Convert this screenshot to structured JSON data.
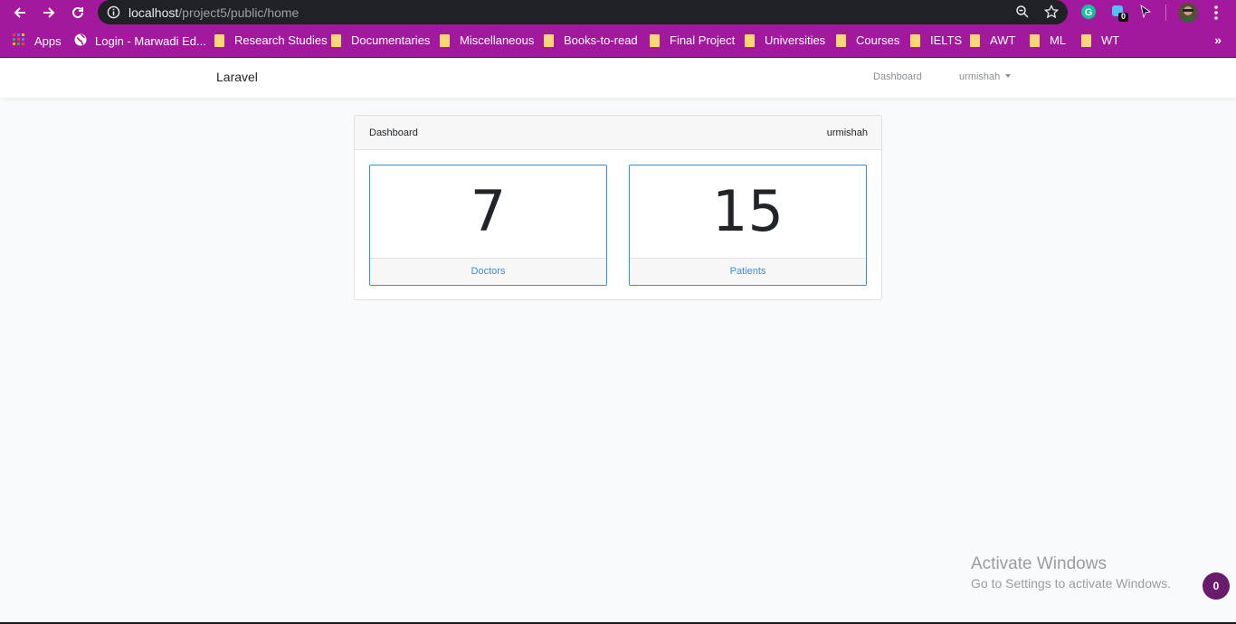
{
  "browser": {
    "url_host": "localhost",
    "url_path": "/project5/public/home",
    "extension_badge": "0",
    "bookmarks": [
      {
        "label": "Apps",
        "icon": "apps-grid-icon"
      },
      {
        "label": "Login - Marwadi Ed...",
        "icon": "globe-icon"
      },
      {
        "label": "Research Studies",
        "icon": "folder-icon"
      },
      {
        "label": "Documentaries",
        "icon": "folder-icon"
      },
      {
        "label": "Miscellaneous",
        "icon": "folder-icon"
      },
      {
        "label": "Books-to-read",
        "icon": "folder-icon"
      },
      {
        "label": "Final Project",
        "icon": "folder-icon"
      },
      {
        "label": "Universities",
        "icon": "folder-icon"
      },
      {
        "label": "Courses",
        "icon": "folder-icon"
      },
      {
        "label": "IELTS",
        "icon": "folder-icon"
      },
      {
        "label": "AWT",
        "icon": "folder-icon"
      },
      {
        "label": "ML",
        "icon": "folder-icon"
      },
      {
        "label": "WT",
        "icon": "folder-icon"
      }
    ],
    "overflow": "»",
    "colors": {
      "toolbar": "#a3199e",
      "omnibox": "#202124"
    }
  },
  "navbar": {
    "brand": "Laravel",
    "dashboard_link": "Dashboard",
    "user_menu": "urmishah"
  },
  "card": {
    "title": "Dashboard",
    "user": "urmishah",
    "stats": [
      {
        "value": "7",
        "label": "Doctors"
      },
      {
        "value": "15",
        "label": "Patients"
      }
    ],
    "accent_color": "#3490dc"
  },
  "watermark": {
    "title": "Activate Windows",
    "subtitle": "Go to Settings to activate Windows."
  },
  "notification_badge": "0"
}
